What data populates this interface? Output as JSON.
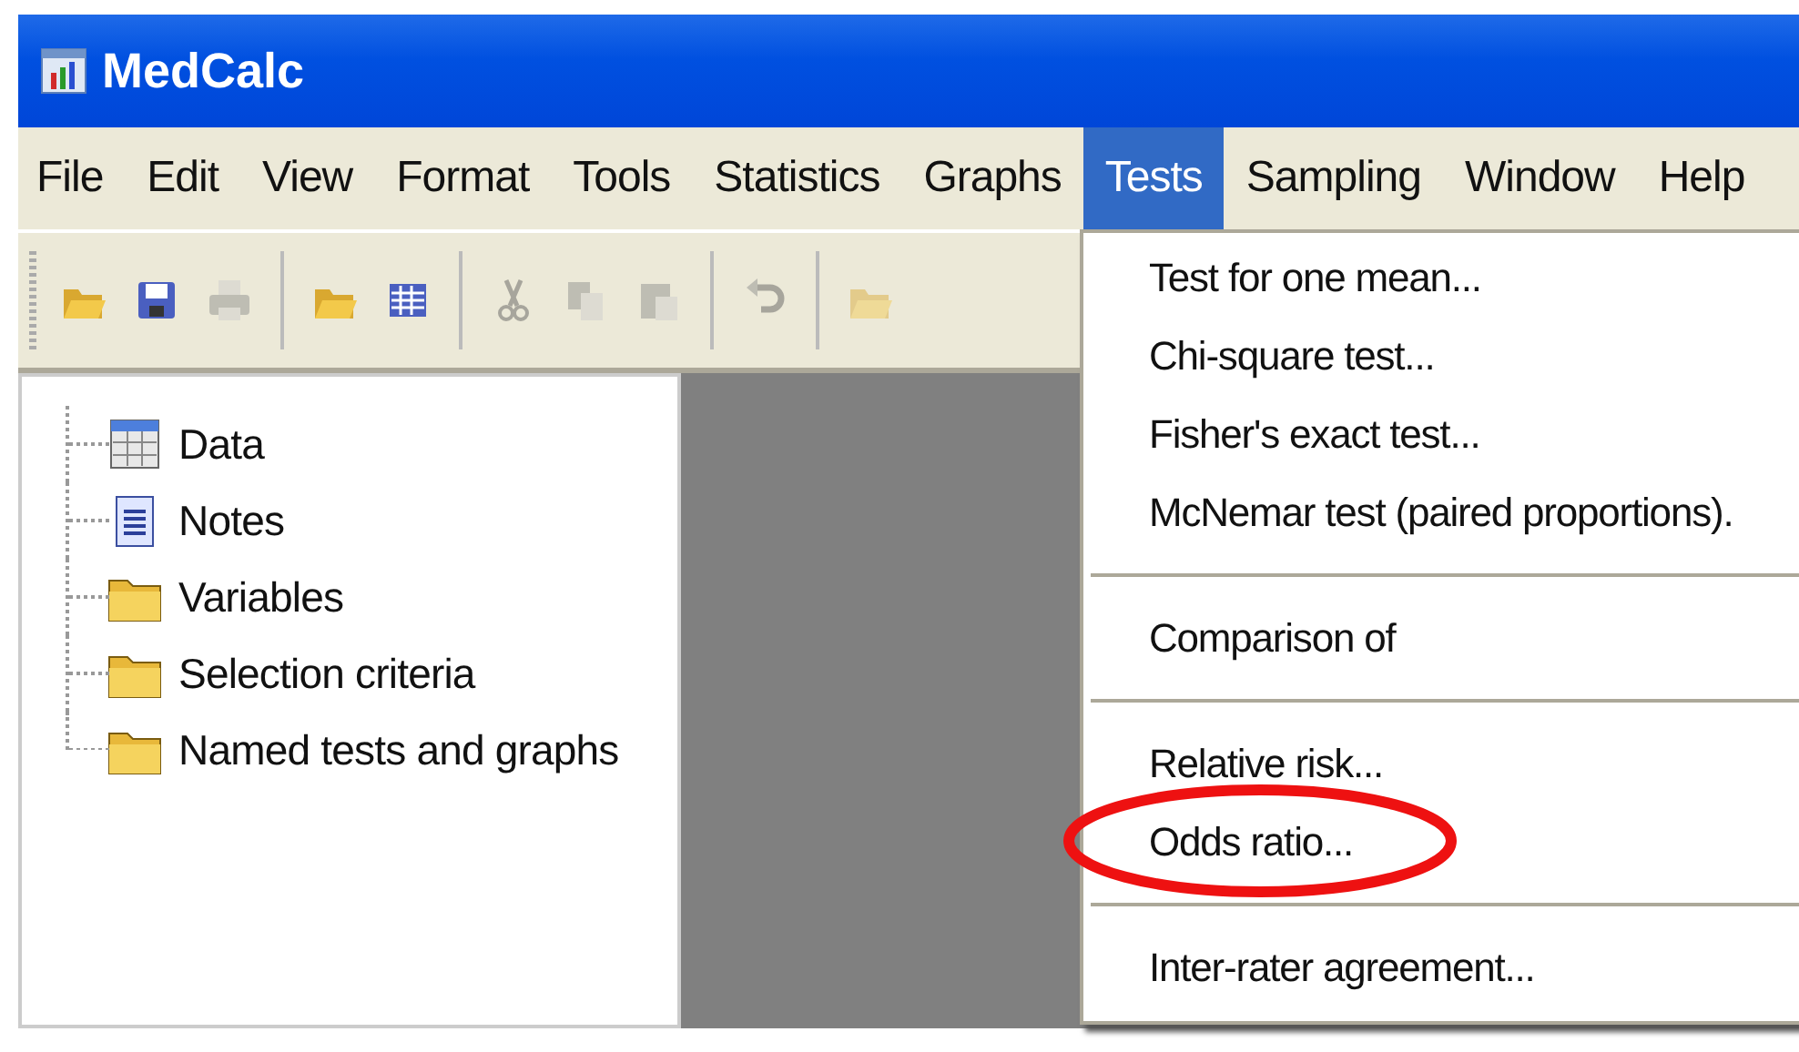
{
  "window": {
    "title": "MedCalc"
  },
  "menu_bar": [
    {
      "label": "File",
      "selected": false
    },
    {
      "label": "Edit",
      "selected": false
    },
    {
      "label": "View",
      "selected": false
    },
    {
      "label": "Format",
      "selected": false
    },
    {
      "label": "Tools",
      "selected": false
    },
    {
      "label": "Statistics",
      "selected": false
    },
    {
      "label": "Graphs",
      "selected": false
    },
    {
      "label": "Tests",
      "selected": true
    },
    {
      "label": "Sampling",
      "selected": false
    },
    {
      "label": "Window",
      "selected": false
    },
    {
      "label": "Help",
      "selected": false
    }
  ],
  "toolbar": [
    [
      {
        "disabled": false
      },
      {
        "disabled": false
      },
      {
        "disabled": true
      }
    ],
    [
      {
        "disabled": false
      },
      {
        "disabled": false
      }
    ],
    [
      {
        "disabled": true
      },
      {
        "disabled": true
      },
      {
        "disabled": true
      }
    ],
    [
      {
        "disabled": true
      }
    ],
    [
      {
        "disabled": true
      }
    ]
  ],
  "tree": {
    "items": [
      {
        "label": "Data"
      },
      {
        "label": "Notes"
      },
      {
        "label": "Variables"
      },
      {
        "label": "Selection criteria"
      },
      {
        "label": "Named tests and graphs"
      }
    ]
  },
  "tests_menu": {
    "items": [
      {
        "kind": "item",
        "label": "Test for one mean...",
        "highlighted": false
      },
      {
        "kind": "item",
        "label": "Chi-square test...",
        "highlighted": false
      },
      {
        "kind": "item",
        "label": "Fisher's exact test...",
        "highlighted": false
      },
      {
        "kind": "item",
        "label": "McNemar test (paired proportions).",
        "highlighted": false
      },
      {
        "kind": "separator"
      },
      {
        "kind": "item",
        "label": "Comparison of",
        "highlighted": false
      },
      {
        "kind": "separator"
      },
      {
        "kind": "item",
        "label": "Relative risk...",
        "highlighted": false
      },
      {
        "kind": "item",
        "label": "Odds ratio...",
        "highlighted": true
      },
      {
        "kind": "separator"
      },
      {
        "kind": "item",
        "label": "Inter-rater agreement...",
        "highlighted": false
      }
    ]
  }
}
